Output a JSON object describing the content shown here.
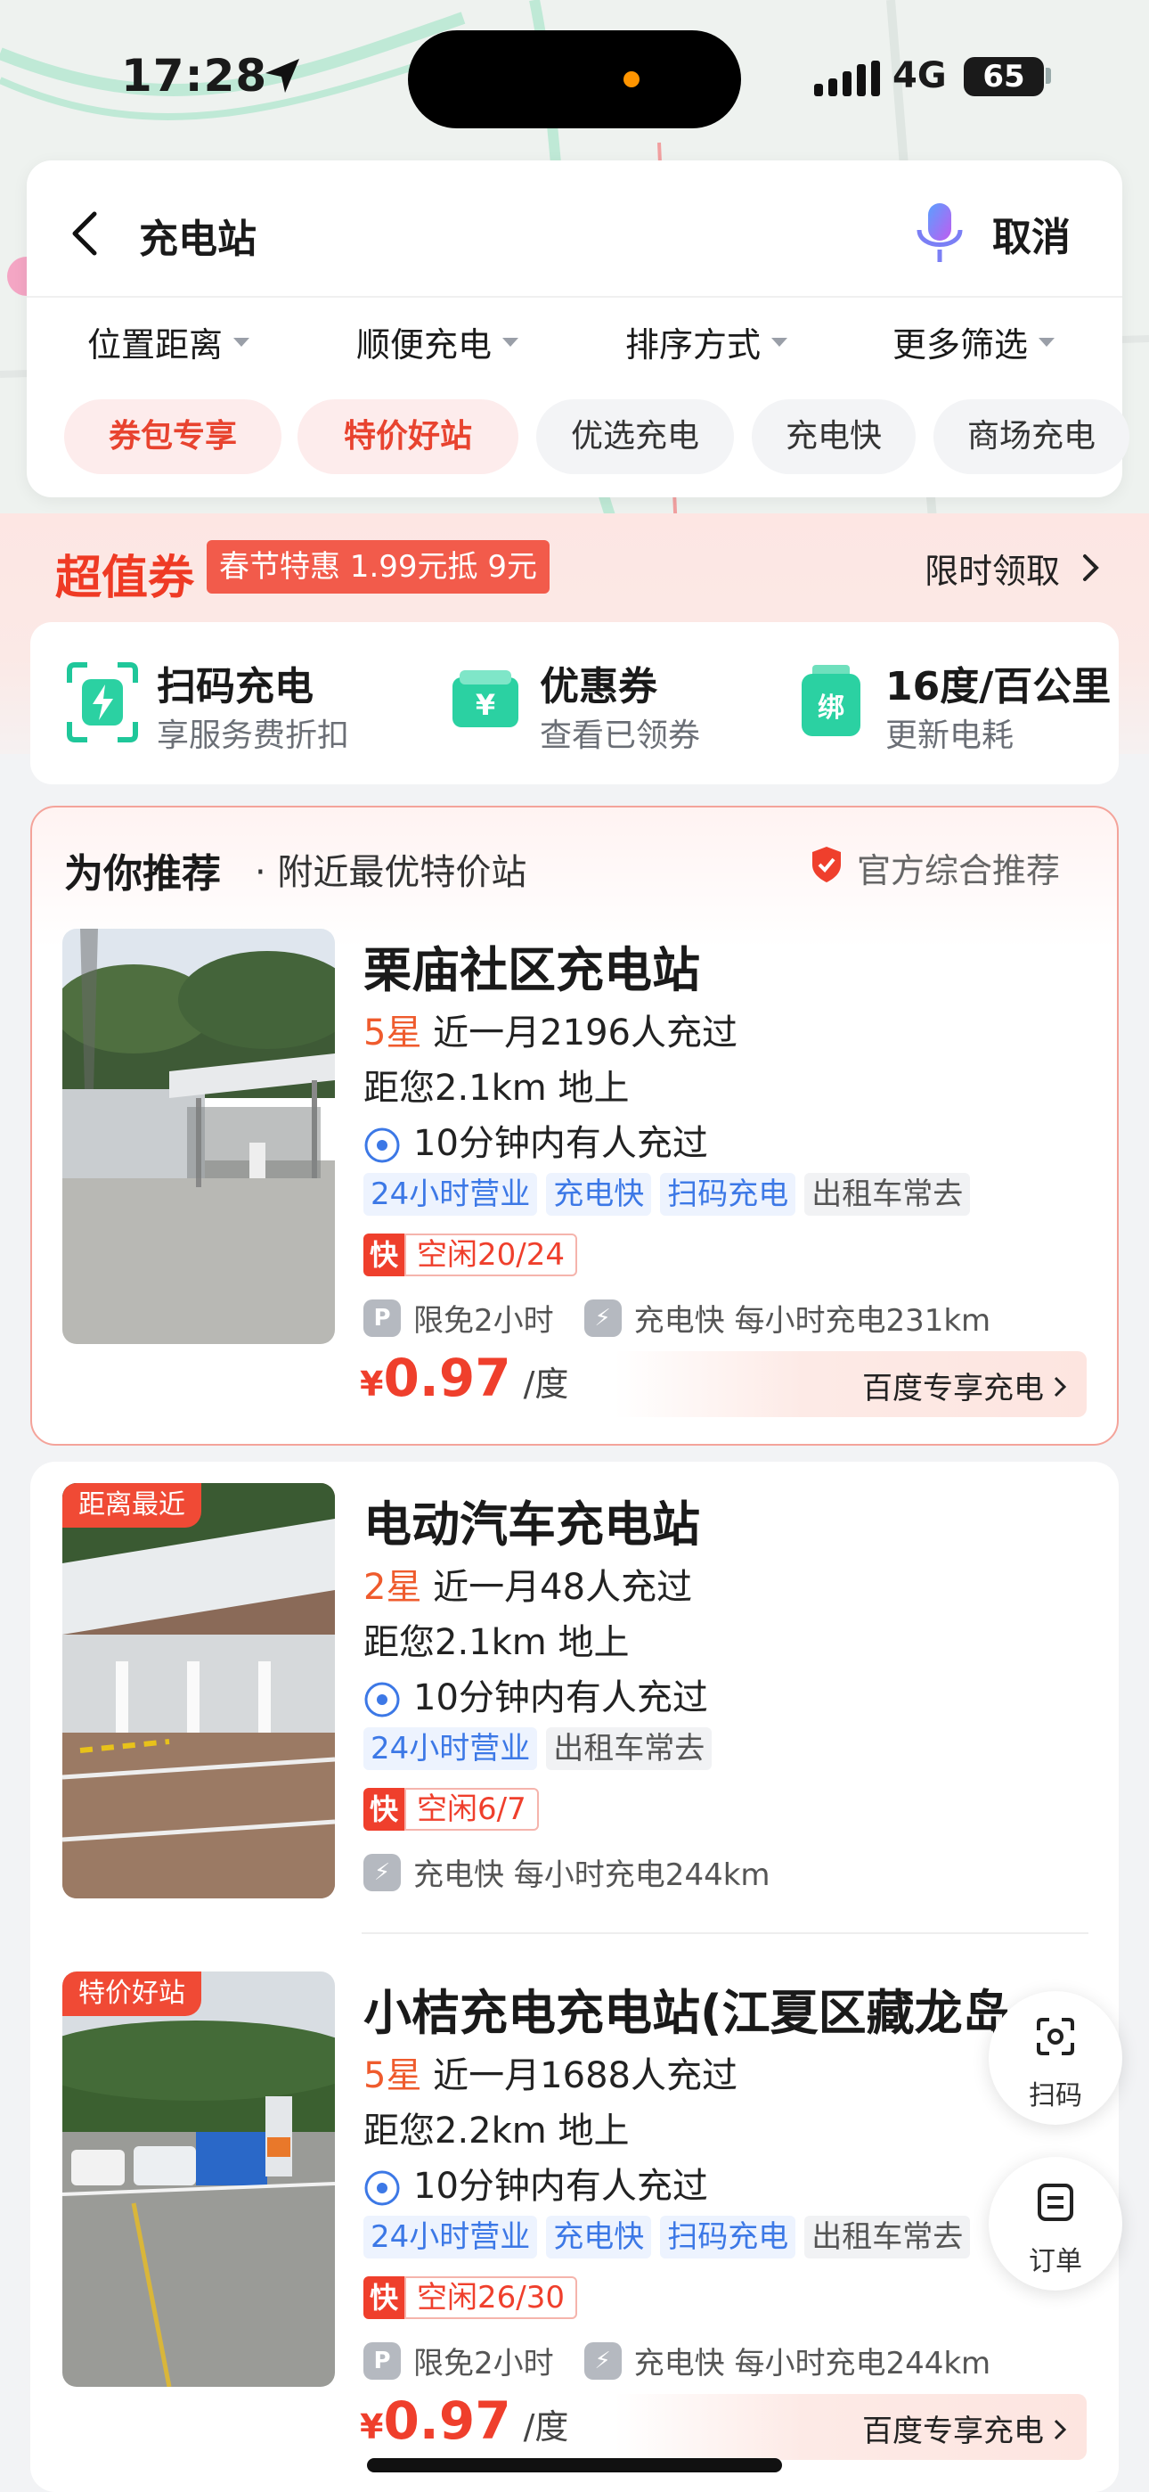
{
  "status_bar": {
    "time": "17:28",
    "network": "4G",
    "battery": "65"
  },
  "header": {
    "title": "充电站",
    "cancel_label": "取消"
  },
  "filters": [
    {
      "label": "位置距离"
    },
    {
      "label": "顺便充电"
    },
    {
      "label": "排序方式"
    },
    {
      "label": "更多筛选"
    }
  ],
  "chips": [
    {
      "label": "券包专享",
      "highlight": true
    },
    {
      "label": "特价好站",
      "highlight": true
    },
    {
      "label": "优选充电",
      "highlight": false
    },
    {
      "label": "充电快",
      "highlight": false
    },
    {
      "label": "商场充电",
      "highlight": false
    }
  ],
  "coupon": {
    "title": "超值券",
    "tag": "春节特惠  1.99元抵 9元",
    "link": "限时领取"
  },
  "services": [
    {
      "title": "扫码充电",
      "subtitle": "享服务费折扣",
      "icon": "scan-charge-icon"
    },
    {
      "title": "优惠券",
      "subtitle": "查看已领券",
      "icon": "coupon-icon"
    },
    {
      "title": "16度/百公里",
      "subtitle": "更新电耗",
      "icon": "bind-car-icon",
      "icon_text": "绑"
    }
  ],
  "recommend": {
    "heading": "为你推荐",
    "sub": "· 附近最优特价站",
    "official": "官方综合推荐"
  },
  "stations": [
    {
      "name": "栗庙社区充电站",
      "stars": "5星",
      "stats": "近一月2196人充过",
      "distance": "距您2.1km  地上",
      "recent": "10分钟内有人充过",
      "tags_blue": [
        "24小时营业",
        "充电快",
        "扫码充电"
      ],
      "tags_gray": [
        "出租车常去"
      ],
      "fast": "快",
      "idle": "空闲20/24",
      "perk_parking": "限免2小时",
      "perk_speed": "充电快 每小时充电231km",
      "currency": "¥",
      "price": "0.97",
      "unit": "/度",
      "exclusive": "百度专享充电"
    },
    {
      "badge": "距离最近",
      "name": "电动汽车充电站",
      "stars": "2星",
      "stats": "近一月48人充过",
      "distance": "距您2.1km  地上",
      "recent": "10分钟内有人充过",
      "tags_blue": [
        "24小时营业"
      ],
      "tags_gray": [
        "出租车常去"
      ],
      "fast": "快",
      "idle": "空闲6/7",
      "perk_speed": "充电快 每小时充电244km"
    },
    {
      "badge": "特价好站",
      "name": "小桔充电充电站(江夏区藏龙岛...",
      "stars": "5星",
      "stats": "近一月1688人充过",
      "distance": "距您2.2km  地上",
      "recent": "10分钟内有人充过",
      "tags_blue": [
        "24小时营业",
        "充电快",
        "扫码充电"
      ],
      "tags_gray": [
        "出租车常去"
      ],
      "fast": "快",
      "idle": "空闲26/30",
      "perk_parking": "限免2小时",
      "perk_speed": "充电快 每小时充电244km",
      "currency": "¥",
      "price": "0.97",
      "unit": "/度",
      "exclusive": "百度专享充电"
    }
  ],
  "fabs": {
    "scan": "扫码",
    "orders": "订单"
  },
  "colors": {
    "accent_red": "#ef3f2c",
    "tag_blue": "#3c78e6",
    "brand_green": "#2bd1a2"
  }
}
